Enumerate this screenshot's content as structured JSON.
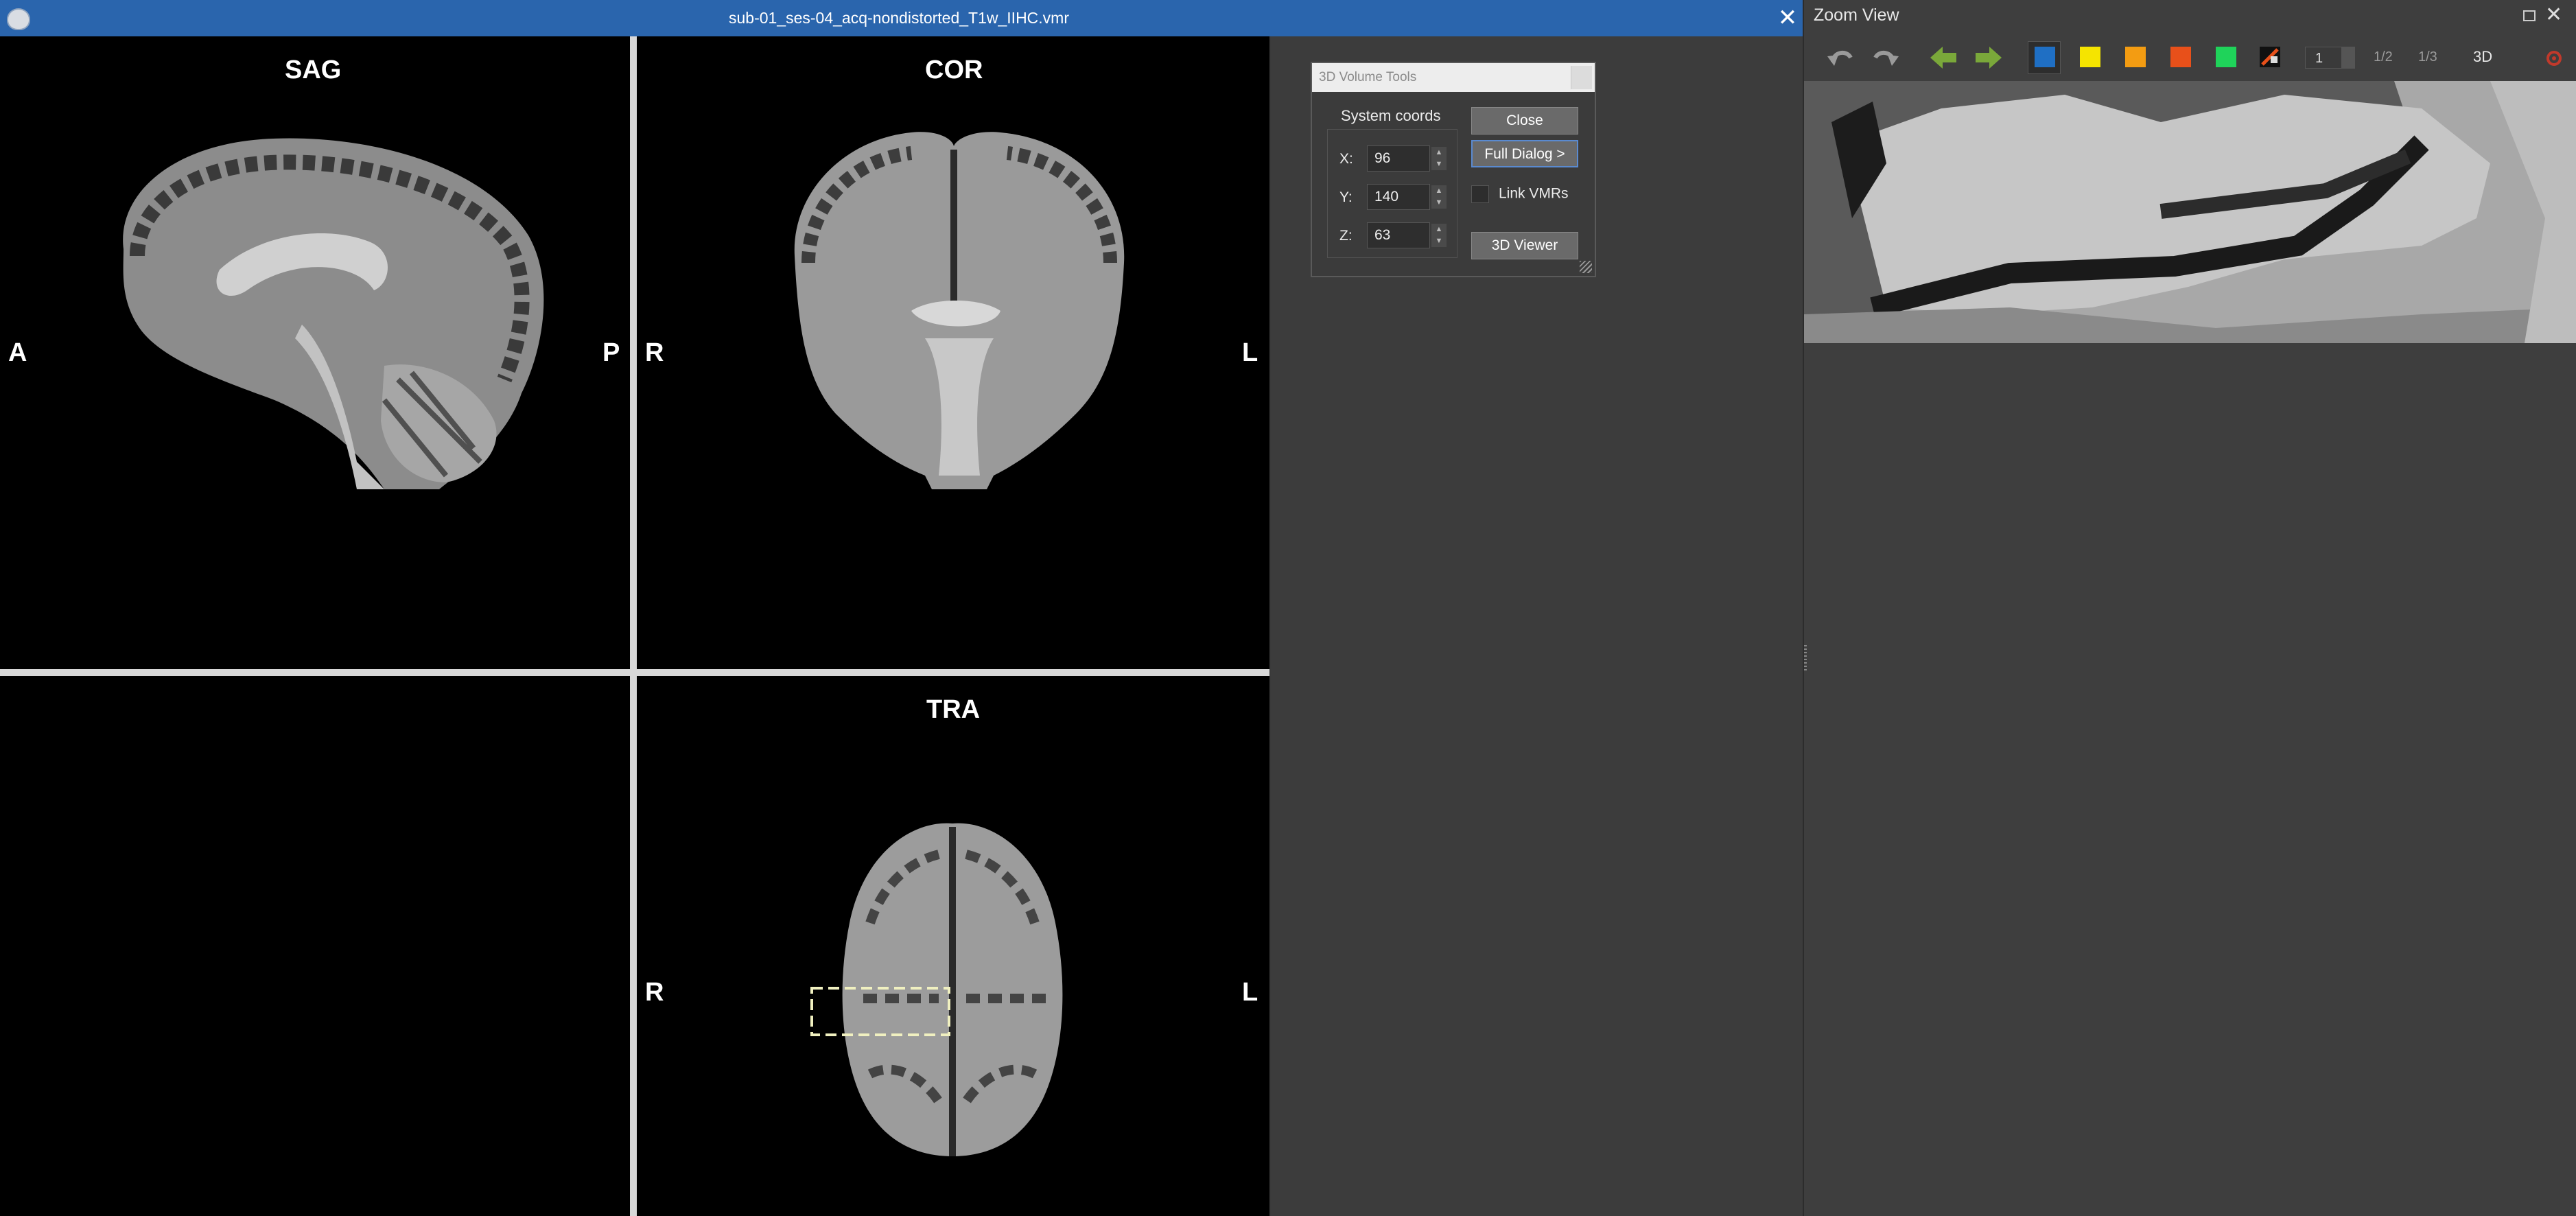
{
  "window": {
    "title": "sub-01_ses-04_acq-nondistorted_T1w_IIHC.vmr",
    "close_glyph": "✕"
  },
  "views": {
    "sag": {
      "title": "SAG",
      "left": "A",
      "right": "P"
    },
    "cor": {
      "title": "COR",
      "left": "R",
      "right": "L"
    },
    "tra": {
      "title": "TRA",
      "left": "R",
      "right": "L"
    }
  },
  "volume_tools": {
    "title": "3D Volume Tools",
    "system_coords_label": "System coords",
    "x_label": "X:",
    "x_value": "96",
    "y_label": "Y:",
    "y_value": "140",
    "z_label": "Z:",
    "z_value": "63",
    "close_label": "Close",
    "full_dialog_label": "Full Dialog >",
    "link_vmrs_label": "Link VMRs",
    "viewer_label": "3D Viewer"
  },
  "zoom_view": {
    "title": "Zoom View",
    "close_glyph": "✕",
    "slice_value": "1",
    "half_label": "1/2",
    "third_label": "1/3",
    "three_d_label": "3D",
    "colors": {
      "blue": "#1f6fc4",
      "yellow": "#f5e400",
      "orange": "#f39c12",
      "red": "#e8501a",
      "green": "#1fd35a"
    },
    "icons": [
      "undo-icon",
      "redo-icon",
      "back-arrow-icon",
      "forward-arrow-icon",
      "settings-icon"
    ]
  }
}
